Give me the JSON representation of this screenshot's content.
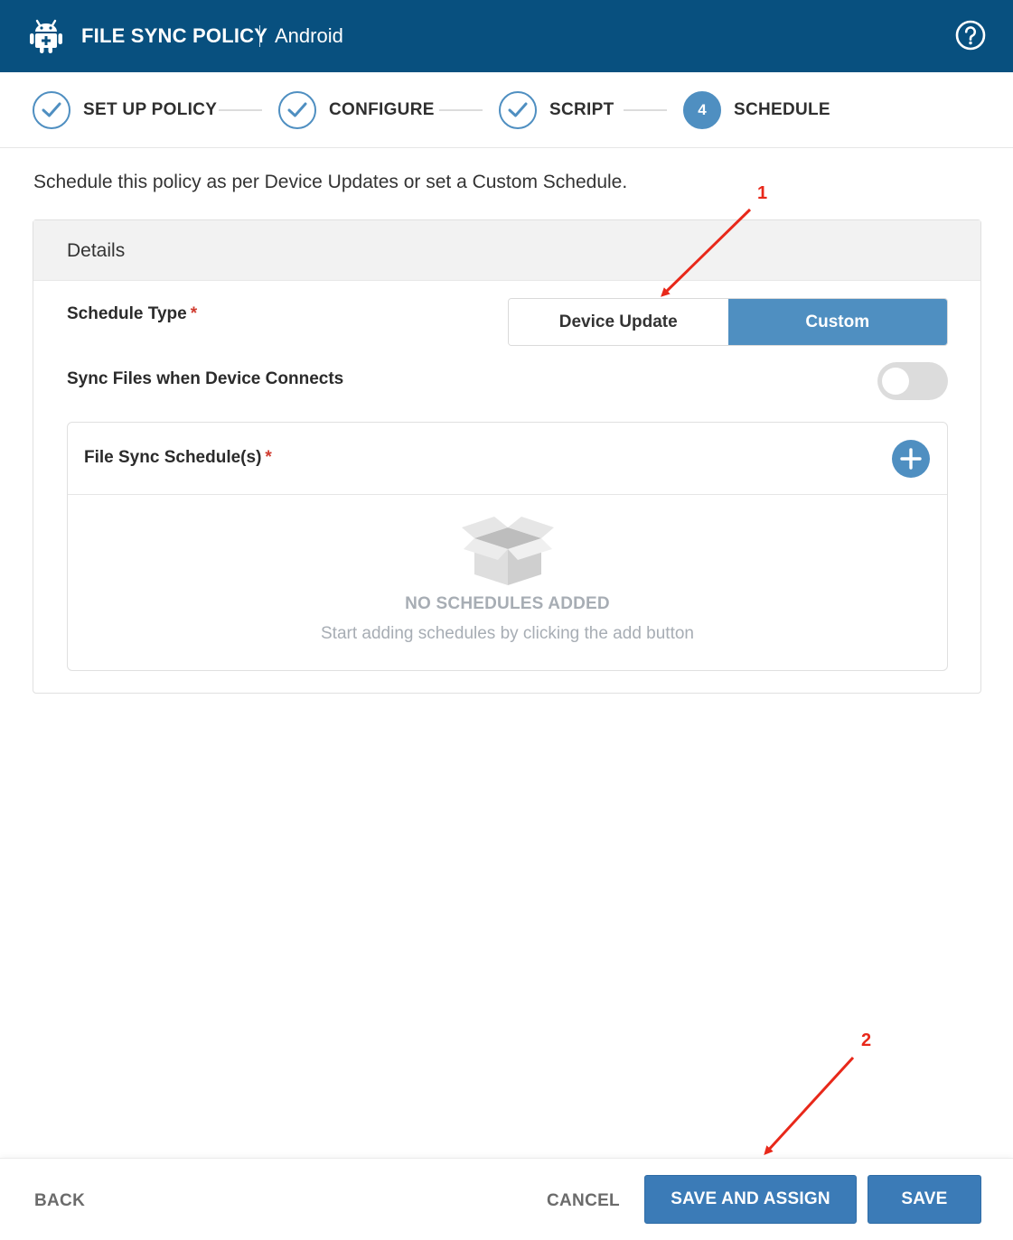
{
  "header": {
    "title": "FILE SYNC POLICY",
    "platform": "Android",
    "logo_icon": "android-icon",
    "help_icon": "help-circle-icon",
    "background": "#08507f"
  },
  "stepper": {
    "steps": [
      {
        "label": "SET UP POLICY",
        "state": "completed",
        "icon": "check-icon"
      },
      {
        "label": "CONFIGURE",
        "state": "completed",
        "icon": "check-icon"
      },
      {
        "label": "SCRIPT",
        "state": "completed",
        "icon": "check-icon"
      },
      {
        "label": "SCHEDULE",
        "state": "active",
        "number": "4"
      }
    ]
  },
  "intro_text": "Schedule this policy as per Device Updates or set a Custom Schedule.",
  "details": {
    "title": "Details",
    "schedule_type": {
      "label": "Schedule Type",
      "required": "*",
      "options": [
        "Device Update",
        "Custom"
      ],
      "selected": "Custom"
    },
    "sync_on_connect": {
      "label": "Sync Files when Device Connects",
      "enabled": false
    },
    "file_sync_schedules": {
      "label": "File Sync Schedule(s)",
      "required": "*",
      "add_icon": "plus-circle-icon",
      "empty_icon": "empty-box-icon",
      "empty_title": "NO SCHEDULES ADDED",
      "empty_subtitle": "Start adding schedules by clicking the add button"
    }
  },
  "footer": {
    "back": "BACK",
    "cancel": "CANCEL",
    "save_and_assign": "SAVE AND ASSIGN",
    "save": "SAVE"
  },
  "annotations": {
    "marker_1": "1",
    "marker_2": "2",
    "color": "#e8281a"
  },
  "colors": {
    "accent": "#4f8fc1",
    "primary_button": "#3b7bb7",
    "required": "#d03b2f"
  }
}
